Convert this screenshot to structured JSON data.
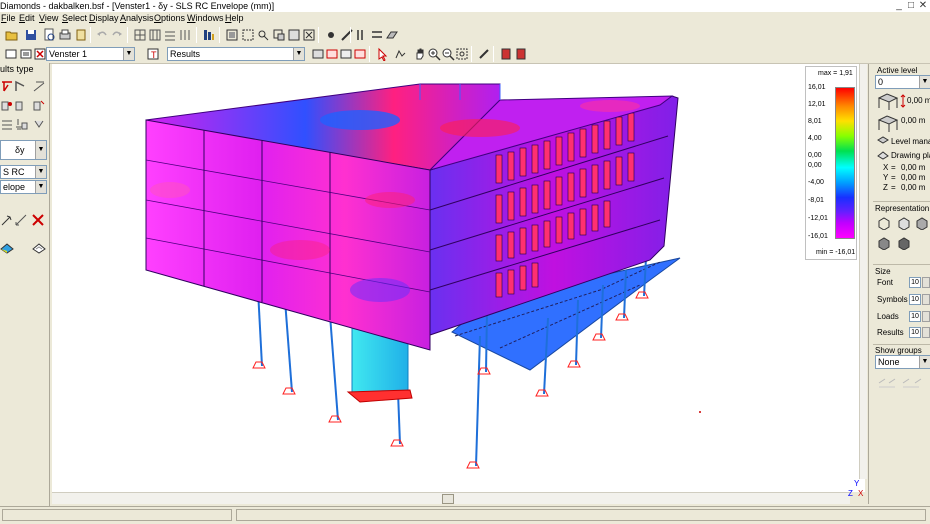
{
  "window": {
    "title": "Diamonds  -  dakbalken.bsf - [Venster1 - δy - SLS RC Envelope  (mm)]"
  },
  "menu": [
    {
      "label": "File",
      "underline": "F"
    },
    {
      "label": "Edit",
      "underline": "E"
    },
    {
      "label": "View",
      "underline": "V"
    },
    {
      "label": "Select",
      "underline": "S"
    },
    {
      "label": "Display",
      "underline": "D"
    },
    {
      "label": "Analysis",
      "underline": "A"
    },
    {
      "label": "Options",
      "underline": "O"
    },
    {
      "label": "Windows",
      "underline": "W"
    },
    {
      "label": "Help",
      "underline": "H"
    }
  ],
  "toolbar2": {
    "view_combo": "Venster 1",
    "results_combo": "Results"
  },
  "left_panel": {
    "results_type_label": "ults type",
    "component_combo": "δy",
    "loadcase_combo": "S RC",
    "envelope_combo": "elope"
  },
  "legend": {
    "max_label": "max = 1,91",
    "min_label": "min = -16,01",
    "ticks": [
      "16,01",
      "12,01",
      "8,01",
      "4,00",
      "0,00",
      "0,00",
      "-4,00",
      "-8,01",
      "-12,01",
      "-16,01"
    ]
  },
  "right_panel": {
    "active_level_label": "Active level",
    "active_level_value": "0",
    "level_top": "0,00 m",
    "level_bottom": "0,00 m",
    "level_manager": "Level manage",
    "drawing_plane": "Drawing plane",
    "coords": [
      {
        "axis": "X",
        "value": "0,00 m"
      },
      {
        "axis": "Y",
        "value": "0,00 m"
      },
      {
        "axis": "Z",
        "value": "0,00 m"
      }
    ],
    "representation_label": "Representation",
    "size_label": "Size",
    "size_rows": [
      {
        "label": "Font",
        "value": "10"
      },
      {
        "label": "Symbols",
        "value": "10"
      },
      {
        "label": "Loads",
        "value": "10"
      },
      {
        "label": "Results",
        "value": "10"
      }
    ],
    "show_groups_label": "Show groups",
    "show_groups_value": "None"
  },
  "axis_labels": {
    "y": "Y",
    "z": "Z",
    "x": "X"
  },
  "colors": {
    "structure_magenta": "#ff00ff",
    "structure_purple": "#8a2be2",
    "column_blue": "#1e6fd9",
    "support_red": "#ff0000"
  }
}
